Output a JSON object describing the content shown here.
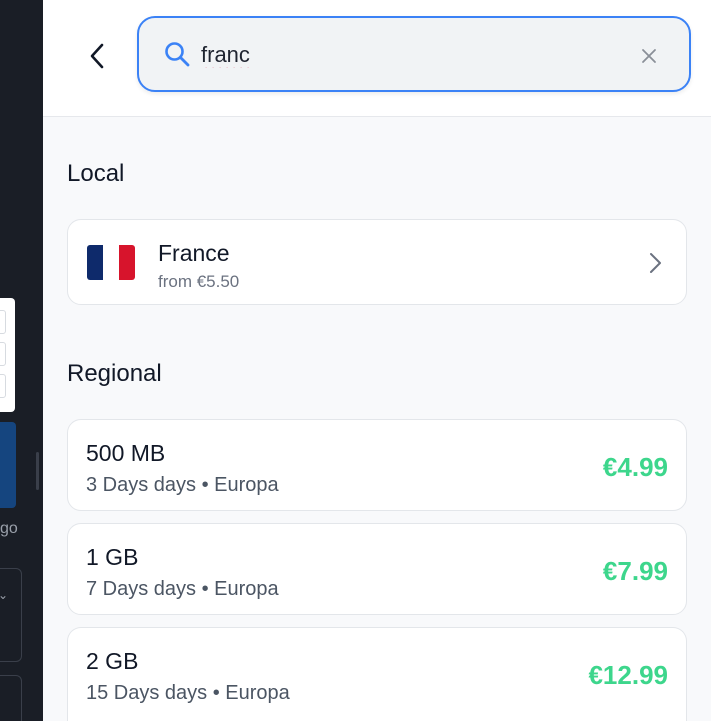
{
  "left_fragment": {
    "text": "go"
  },
  "search": {
    "value": "franc"
  },
  "sections": {
    "local_title": "Local",
    "regional_title": "Regional"
  },
  "local": {
    "country": "France",
    "price": "from €5.50",
    "flag_colors": [
      "#0e2a6b",
      "#ffffff",
      "#d7142c"
    ]
  },
  "regional": [
    {
      "size": "500 MB",
      "meta": "3 Days days • Europa",
      "price": "€4.99"
    },
    {
      "size": "1 GB",
      "meta": "7 Days days • Europa",
      "price": "€7.99"
    },
    {
      "size": "2 GB",
      "meta": "15 Days days • Europa",
      "price": "€12.99"
    }
  ],
  "colors": {
    "accent": "#3b82f6",
    "price": "#3dd68c"
  }
}
